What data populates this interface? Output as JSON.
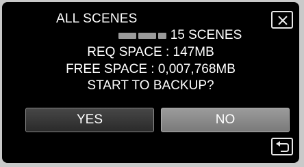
{
  "dialog": {
    "title": "ALL SCENES",
    "scene_count": "15 SCENES",
    "req_space": "REQ SPACE : 147MB",
    "free_space": "FREE SPACE : 0,007,768MB",
    "prompt": "START TO BACKUP?"
  },
  "buttons": {
    "yes_label": "YES",
    "no_label": "NO"
  },
  "icons": {
    "close": "close-icon",
    "back": "back-return-icon"
  },
  "colors": {
    "background": "#000000",
    "text": "#ffffff",
    "yes_button": "#3a3a3a",
    "no_button_selected": "#8a8a8a"
  }
}
